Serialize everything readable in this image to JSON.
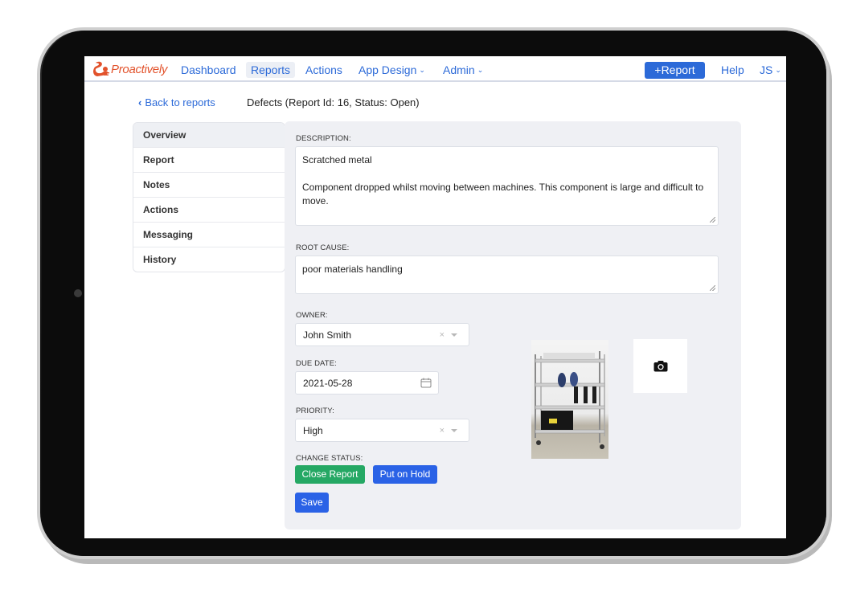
{
  "nav": {
    "logo_text": "Proactively",
    "brand_color": "#e2522b",
    "accent_color": "#2c6ad8",
    "links": [
      {
        "label": "Dashboard",
        "active": false,
        "dropdown": false
      },
      {
        "label": "Reports",
        "active": true,
        "dropdown": false
      },
      {
        "label": "Actions",
        "active": false,
        "dropdown": false
      },
      {
        "label": "App Design",
        "active": false,
        "dropdown": true
      },
      {
        "label": "Admin",
        "active": false,
        "dropdown": true
      }
    ],
    "add_report_label": "+Report",
    "help_label": "Help",
    "user_initials": "JS"
  },
  "header": {
    "back_label": "Back to reports",
    "title": "Defects (Report Id: 16, Status: Open)"
  },
  "sidebar": {
    "items": [
      {
        "label": "Overview",
        "active": true
      },
      {
        "label": "Report",
        "active": false
      },
      {
        "label": "Notes",
        "active": false
      },
      {
        "label": "Actions",
        "active": false
      },
      {
        "label": "Messaging",
        "active": false
      },
      {
        "label": "History",
        "active": false
      }
    ]
  },
  "form": {
    "description_label": "DESCRIPTION:",
    "description_line1": "Scratched metal",
    "description_line2": "Component dropped whilst moving between machines.  This component is large and difficult to move.",
    "root_cause_label": "ROOT CAUSE:",
    "root_cause_value": "poor materials handling",
    "owner_label": "OWNER:",
    "owner_value": "John Smith",
    "due_date_label": "DUE DATE:",
    "due_date_value": "2021-05-28",
    "priority_label": "PRIORITY:",
    "priority_value": "High",
    "change_status_label": "CHANGE STATUS:",
    "close_report_label": "Close Report",
    "put_on_hold_label": "Put on Hold",
    "save_label": "Save",
    "clear_glyph": "×"
  },
  "attachments": {
    "photo_alt": "Wire shelving rack with black storage box",
    "camera_icon": "camera-icon"
  }
}
